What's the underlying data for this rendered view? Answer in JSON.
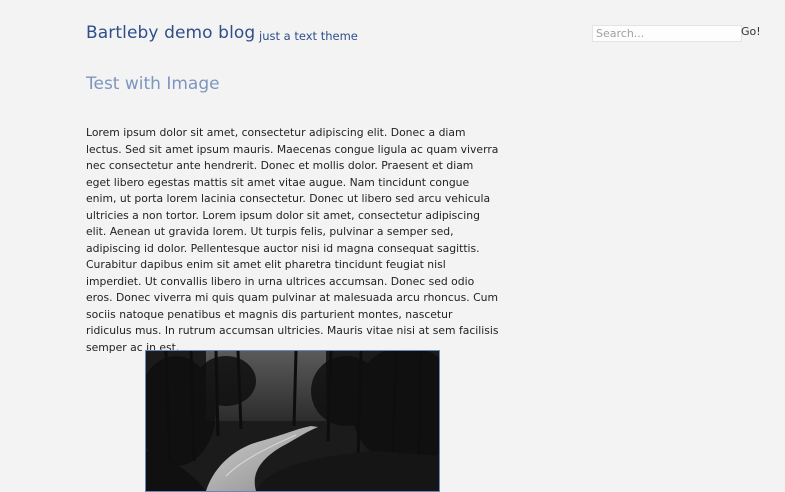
{
  "site": {
    "title": "Bartleby demo blog",
    "tagline": "just a text theme"
  },
  "search": {
    "placeholder": "Search...",
    "button_label": "Go!"
  },
  "post": {
    "title": "Test with Image",
    "body": "Lorem ipsum dolor sit amet, consectetur adipiscing elit. Donec a diam lectus. Sed sit amet ipsum mauris. Maecenas congue ligula ac quam viverra nec consectetur ante hendrerit. Donec et mollis dolor. Praesent et diam eget libero egestas mattis sit amet vitae augue. Nam tincidunt congue enim, ut porta lorem lacinia consectetur. Donec ut libero sed arcu vehicula ultricies a non tortor. Lorem ipsum dolor sit amet, consectetur adipiscing elit. Aenean ut gravida lorem. Ut turpis felis, pulvinar a semper sed, adipiscing id dolor. Pellentesque auctor nisi id magna consequat sagittis. Curabitur dapibus enim sit amet elit pharetra tincidunt feugiat nisl imperdiet. Ut convallis libero in urna ultrices accumsan. Donec sed odio eros. Donec viverra mi quis quam pulvinar at malesuada arcu rhoncus. Cum sociis natoque penatibus et magnis dis parturient montes, nascetur ridiculus mus. In rutrum accumsan ultricies. Mauris vitae nisi at sem facilisis semper ac in est."
  },
  "colors": {
    "link": "#2f4f8a",
    "post_title": "#7d95c0",
    "image_border": "#6c88b8",
    "background": "#f3f3f3"
  }
}
